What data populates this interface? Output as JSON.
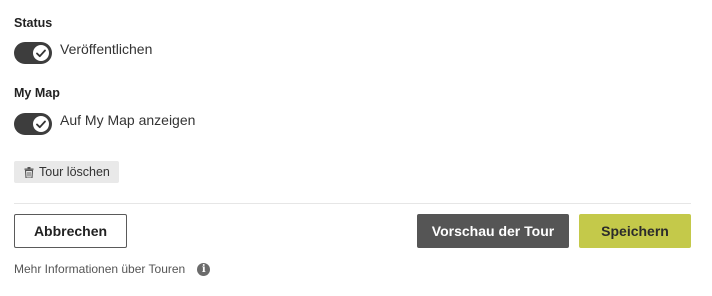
{
  "status": {
    "heading": "Status",
    "toggle_label": "Veröffentlichen",
    "toggle_on": true
  },
  "mymap": {
    "heading": "My Map",
    "toggle_label": "Auf My Map anzeigen",
    "toggle_on": true
  },
  "delete": {
    "label": "Tour löschen",
    "icon": "trash-icon"
  },
  "actions": {
    "cancel_label": "Abbrechen",
    "preview_label": "Vorschau der Tour",
    "save_label": "Speichern"
  },
  "footer": {
    "info_text": "Mehr Informationen über Touren",
    "info_icon": "info-icon"
  },
  "colors": {
    "save_accent": "#c4c94a",
    "preview_bg": "#555555",
    "toggle_bg": "#3d3d3d"
  }
}
